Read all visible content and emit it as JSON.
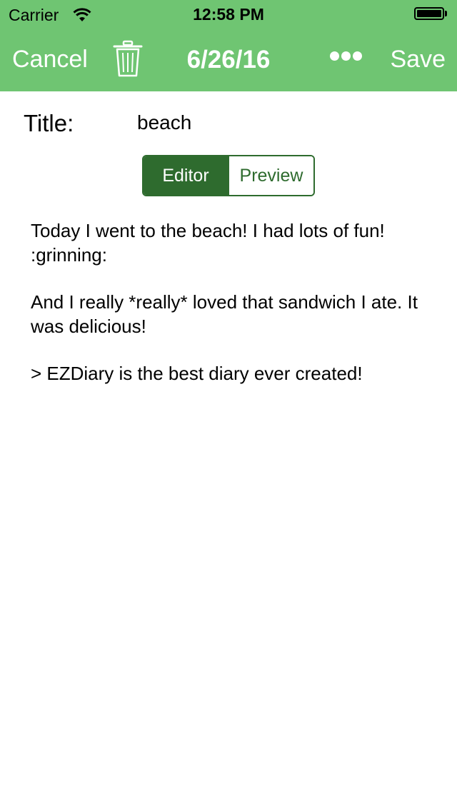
{
  "status_bar": {
    "carrier": "Carrier",
    "time": "12:58 PM",
    "wifi_icon": "wifi-icon",
    "battery_icon": "battery-icon"
  },
  "nav_bar": {
    "cancel_label": "Cancel",
    "trash_icon": "trash-icon",
    "title": "6/26/16",
    "more_icon": "more-dots-icon",
    "save_label": "Save",
    "background_color": "#6fc572"
  },
  "entry": {
    "title_label": "Title:",
    "title_value": "beach"
  },
  "segmented_control": {
    "options": [
      "Editor",
      "Preview"
    ],
    "selected": "Editor",
    "accent_color": "#2e6b2e"
  },
  "editor": {
    "paragraphs": [
      "Today I went to the beach! I had lots of fun! :grinning:",
      "And I really *really* loved that sandwich I ate. It was delicious!",
      "> EZDiary is the best diary ever created!"
    ]
  }
}
